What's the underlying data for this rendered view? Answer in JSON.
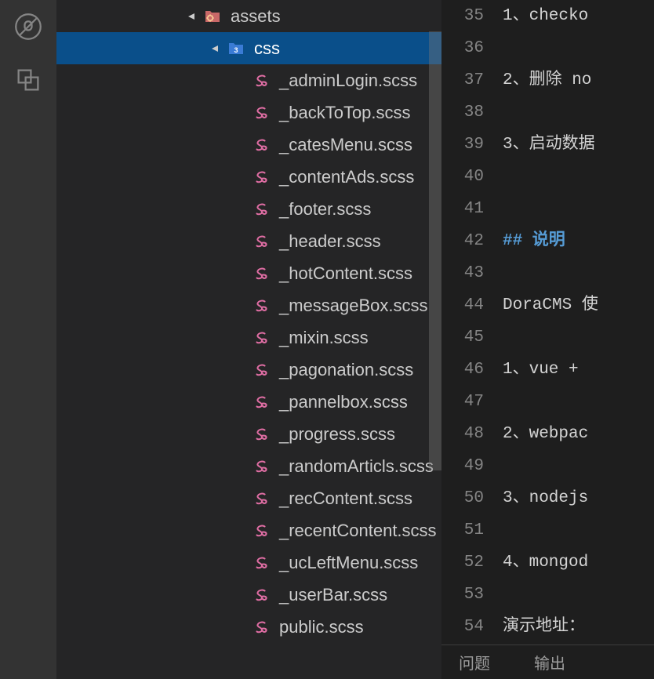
{
  "activity_bar": {
    "icons": [
      "bug-disabled-icon",
      "references-icon"
    ]
  },
  "explorer": {
    "folders": [
      {
        "name": "assets",
        "expanded": true,
        "level": "assets",
        "icon": "folder-gear"
      },
      {
        "name": "css",
        "expanded": true,
        "level": "css",
        "icon": "folder-css",
        "selected": true
      }
    ],
    "files": [
      "_adminLogin.scss",
      "_backToTop.scss",
      "_catesMenu.scss",
      "_contentAds.scss",
      "_footer.scss",
      "_header.scss",
      "_hotContent.scss",
      "_messageBox.scss",
      "_mixin.scss",
      "_pagonation.scss",
      "_pannelbox.scss",
      "_progress.scss",
      "_randomArticls.scss",
      "_recContent.scss",
      "_recentContent.scss",
      "_ucLeftMenu.scss",
      "_userBar.scss",
      "public.scss"
    ]
  },
  "editor": {
    "line_start": 35,
    "lines": [
      "1、checko",
      "",
      "2、删除 no",
      "",
      "3、启动数据",
      "",
      "",
      "## 说明",
      "",
      "DoraCMS 使",
      "",
      "1、vue +",
      "",
      "2、webpac",
      "",
      "3、nodejs",
      "",
      "4、mongod",
      "",
      "演示地址："
    ],
    "heading_lines": [
      42
    ]
  },
  "bottom_tabs": [
    "问题",
    "输出"
  ]
}
